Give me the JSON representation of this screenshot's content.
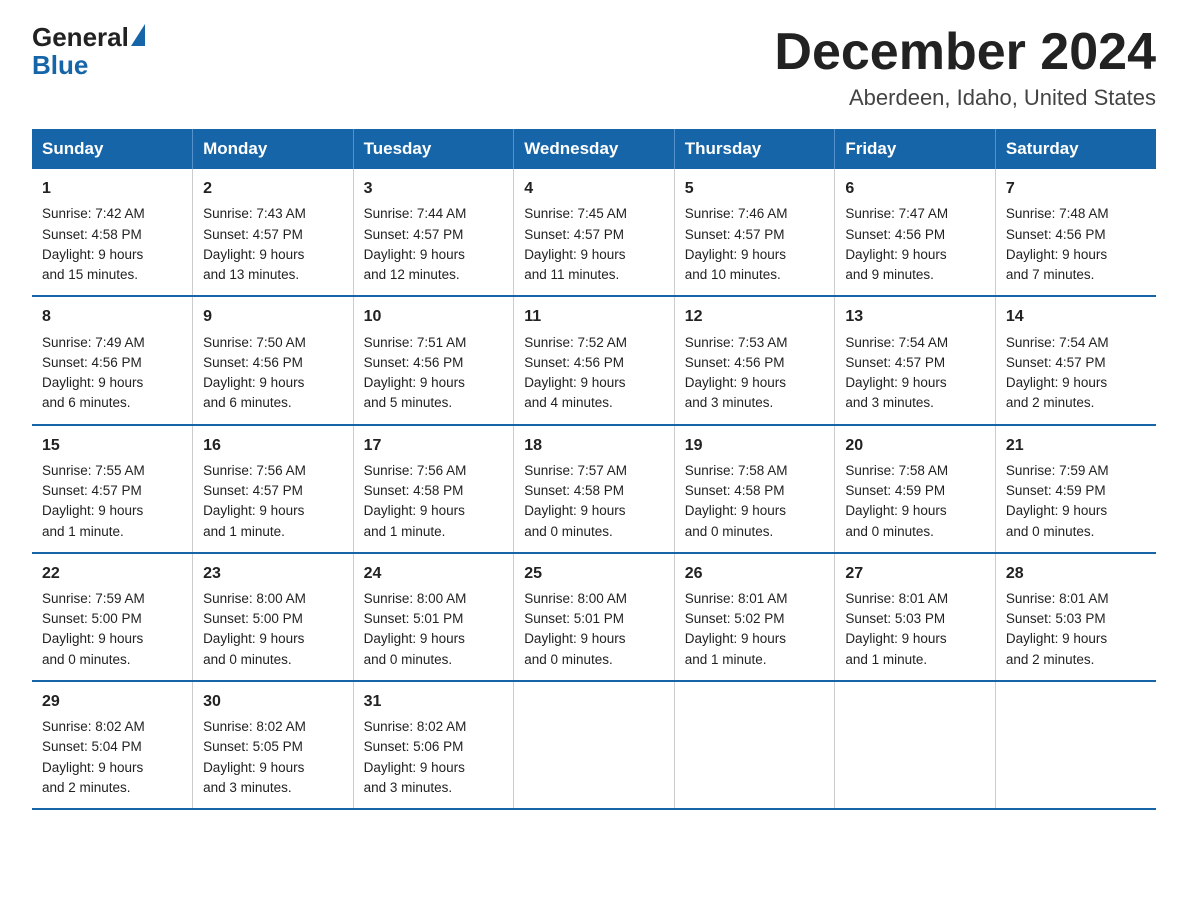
{
  "header": {
    "logo_general": "General",
    "logo_blue": "Blue",
    "month_title": "December 2024",
    "location": "Aberdeen, Idaho, United States"
  },
  "weekdays": [
    "Sunday",
    "Monday",
    "Tuesday",
    "Wednesday",
    "Thursday",
    "Friday",
    "Saturday"
  ],
  "weeks": [
    [
      {
        "day": "1",
        "info": "Sunrise: 7:42 AM\nSunset: 4:58 PM\nDaylight: 9 hours\nand 15 minutes."
      },
      {
        "day": "2",
        "info": "Sunrise: 7:43 AM\nSunset: 4:57 PM\nDaylight: 9 hours\nand 13 minutes."
      },
      {
        "day": "3",
        "info": "Sunrise: 7:44 AM\nSunset: 4:57 PM\nDaylight: 9 hours\nand 12 minutes."
      },
      {
        "day": "4",
        "info": "Sunrise: 7:45 AM\nSunset: 4:57 PM\nDaylight: 9 hours\nand 11 minutes."
      },
      {
        "day": "5",
        "info": "Sunrise: 7:46 AM\nSunset: 4:57 PM\nDaylight: 9 hours\nand 10 minutes."
      },
      {
        "day": "6",
        "info": "Sunrise: 7:47 AM\nSunset: 4:56 PM\nDaylight: 9 hours\nand 9 minutes."
      },
      {
        "day": "7",
        "info": "Sunrise: 7:48 AM\nSunset: 4:56 PM\nDaylight: 9 hours\nand 7 minutes."
      }
    ],
    [
      {
        "day": "8",
        "info": "Sunrise: 7:49 AM\nSunset: 4:56 PM\nDaylight: 9 hours\nand 6 minutes."
      },
      {
        "day": "9",
        "info": "Sunrise: 7:50 AM\nSunset: 4:56 PM\nDaylight: 9 hours\nand 6 minutes."
      },
      {
        "day": "10",
        "info": "Sunrise: 7:51 AM\nSunset: 4:56 PM\nDaylight: 9 hours\nand 5 minutes."
      },
      {
        "day": "11",
        "info": "Sunrise: 7:52 AM\nSunset: 4:56 PM\nDaylight: 9 hours\nand 4 minutes."
      },
      {
        "day": "12",
        "info": "Sunrise: 7:53 AM\nSunset: 4:56 PM\nDaylight: 9 hours\nand 3 minutes."
      },
      {
        "day": "13",
        "info": "Sunrise: 7:54 AM\nSunset: 4:57 PM\nDaylight: 9 hours\nand 3 minutes."
      },
      {
        "day": "14",
        "info": "Sunrise: 7:54 AM\nSunset: 4:57 PM\nDaylight: 9 hours\nand 2 minutes."
      }
    ],
    [
      {
        "day": "15",
        "info": "Sunrise: 7:55 AM\nSunset: 4:57 PM\nDaylight: 9 hours\nand 1 minute."
      },
      {
        "day": "16",
        "info": "Sunrise: 7:56 AM\nSunset: 4:57 PM\nDaylight: 9 hours\nand 1 minute."
      },
      {
        "day": "17",
        "info": "Sunrise: 7:56 AM\nSunset: 4:58 PM\nDaylight: 9 hours\nand 1 minute."
      },
      {
        "day": "18",
        "info": "Sunrise: 7:57 AM\nSunset: 4:58 PM\nDaylight: 9 hours\nand 0 minutes."
      },
      {
        "day": "19",
        "info": "Sunrise: 7:58 AM\nSunset: 4:58 PM\nDaylight: 9 hours\nand 0 minutes."
      },
      {
        "day": "20",
        "info": "Sunrise: 7:58 AM\nSunset: 4:59 PM\nDaylight: 9 hours\nand 0 minutes."
      },
      {
        "day": "21",
        "info": "Sunrise: 7:59 AM\nSunset: 4:59 PM\nDaylight: 9 hours\nand 0 minutes."
      }
    ],
    [
      {
        "day": "22",
        "info": "Sunrise: 7:59 AM\nSunset: 5:00 PM\nDaylight: 9 hours\nand 0 minutes."
      },
      {
        "day": "23",
        "info": "Sunrise: 8:00 AM\nSunset: 5:00 PM\nDaylight: 9 hours\nand 0 minutes."
      },
      {
        "day": "24",
        "info": "Sunrise: 8:00 AM\nSunset: 5:01 PM\nDaylight: 9 hours\nand 0 minutes."
      },
      {
        "day": "25",
        "info": "Sunrise: 8:00 AM\nSunset: 5:01 PM\nDaylight: 9 hours\nand 0 minutes."
      },
      {
        "day": "26",
        "info": "Sunrise: 8:01 AM\nSunset: 5:02 PM\nDaylight: 9 hours\nand 1 minute."
      },
      {
        "day": "27",
        "info": "Sunrise: 8:01 AM\nSunset: 5:03 PM\nDaylight: 9 hours\nand 1 minute."
      },
      {
        "day": "28",
        "info": "Sunrise: 8:01 AM\nSunset: 5:03 PM\nDaylight: 9 hours\nand 2 minutes."
      }
    ],
    [
      {
        "day": "29",
        "info": "Sunrise: 8:02 AM\nSunset: 5:04 PM\nDaylight: 9 hours\nand 2 minutes."
      },
      {
        "day": "30",
        "info": "Sunrise: 8:02 AM\nSunset: 5:05 PM\nDaylight: 9 hours\nand 3 minutes."
      },
      {
        "day": "31",
        "info": "Sunrise: 8:02 AM\nSunset: 5:06 PM\nDaylight: 9 hours\nand 3 minutes."
      },
      {
        "day": "",
        "info": ""
      },
      {
        "day": "",
        "info": ""
      },
      {
        "day": "",
        "info": ""
      },
      {
        "day": "",
        "info": ""
      }
    ]
  ]
}
